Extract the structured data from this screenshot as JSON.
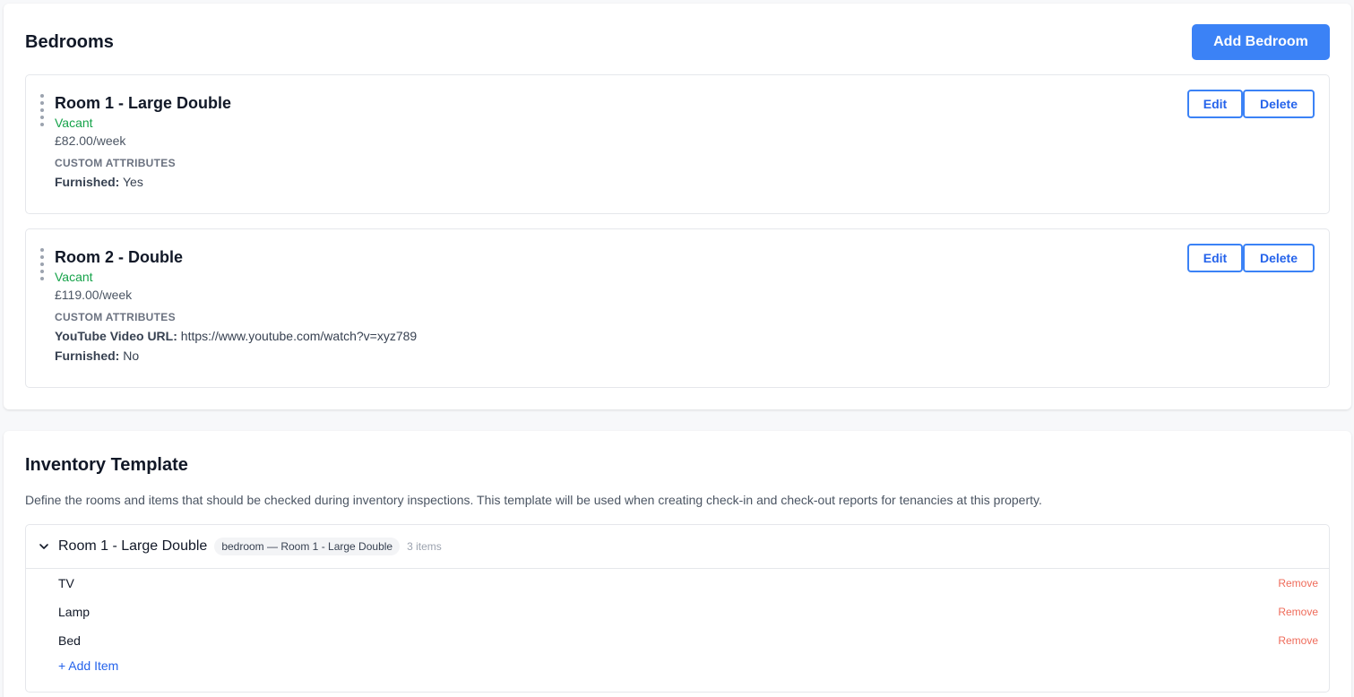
{
  "bedrooms": {
    "title": "Bedrooms",
    "add_button": "Add Bedroom",
    "rooms": [
      {
        "name": "Room 1 - Large Double",
        "status": "Vacant",
        "price": "£82.00/week",
        "attributes_heading": "CUSTOM ATTRIBUTES",
        "attributes": [
          {
            "key": "Furnished:",
            "value": "Yes"
          }
        ],
        "edit_label": "Edit",
        "delete_label": "Delete"
      },
      {
        "name": "Room 2 - Double",
        "status": "Vacant",
        "price": "£119.00/week",
        "attributes_heading": "CUSTOM ATTRIBUTES",
        "attributes": [
          {
            "key": "YouTube Video URL:",
            "value": "https://www.youtube.com/watch?v=xyz789"
          },
          {
            "key": "Furnished:",
            "value": "No"
          }
        ],
        "edit_label": "Edit",
        "delete_label": "Delete"
      }
    ]
  },
  "inventory": {
    "title": "Inventory Template",
    "description": "Define the rooms and items that should be checked during inventory inspections. This template will be used when creating check-in and check-out reports for tenancies at this property.",
    "rooms": [
      {
        "name": "Room 1 - Large Double",
        "tag": "bedroom — Room 1 - Large Double",
        "count": "3 items",
        "expand_icon": "chevron-down-icon",
        "items": [
          {
            "name": "TV",
            "remove_label": "Remove"
          },
          {
            "name": "Lamp",
            "remove_label": "Remove"
          },
          {
            "name": "Bed",
            "remove_label": "Remove"
          }
        ],
        "add_item_label": "+ Add Item"
      }
    ]
  },
  "colors": {
    "primary": "#3b82f6",
    "status_vacant": "#16a34a",
    "remove": "#ef6b5a",
    "link": "#2563eb"
  }
}
